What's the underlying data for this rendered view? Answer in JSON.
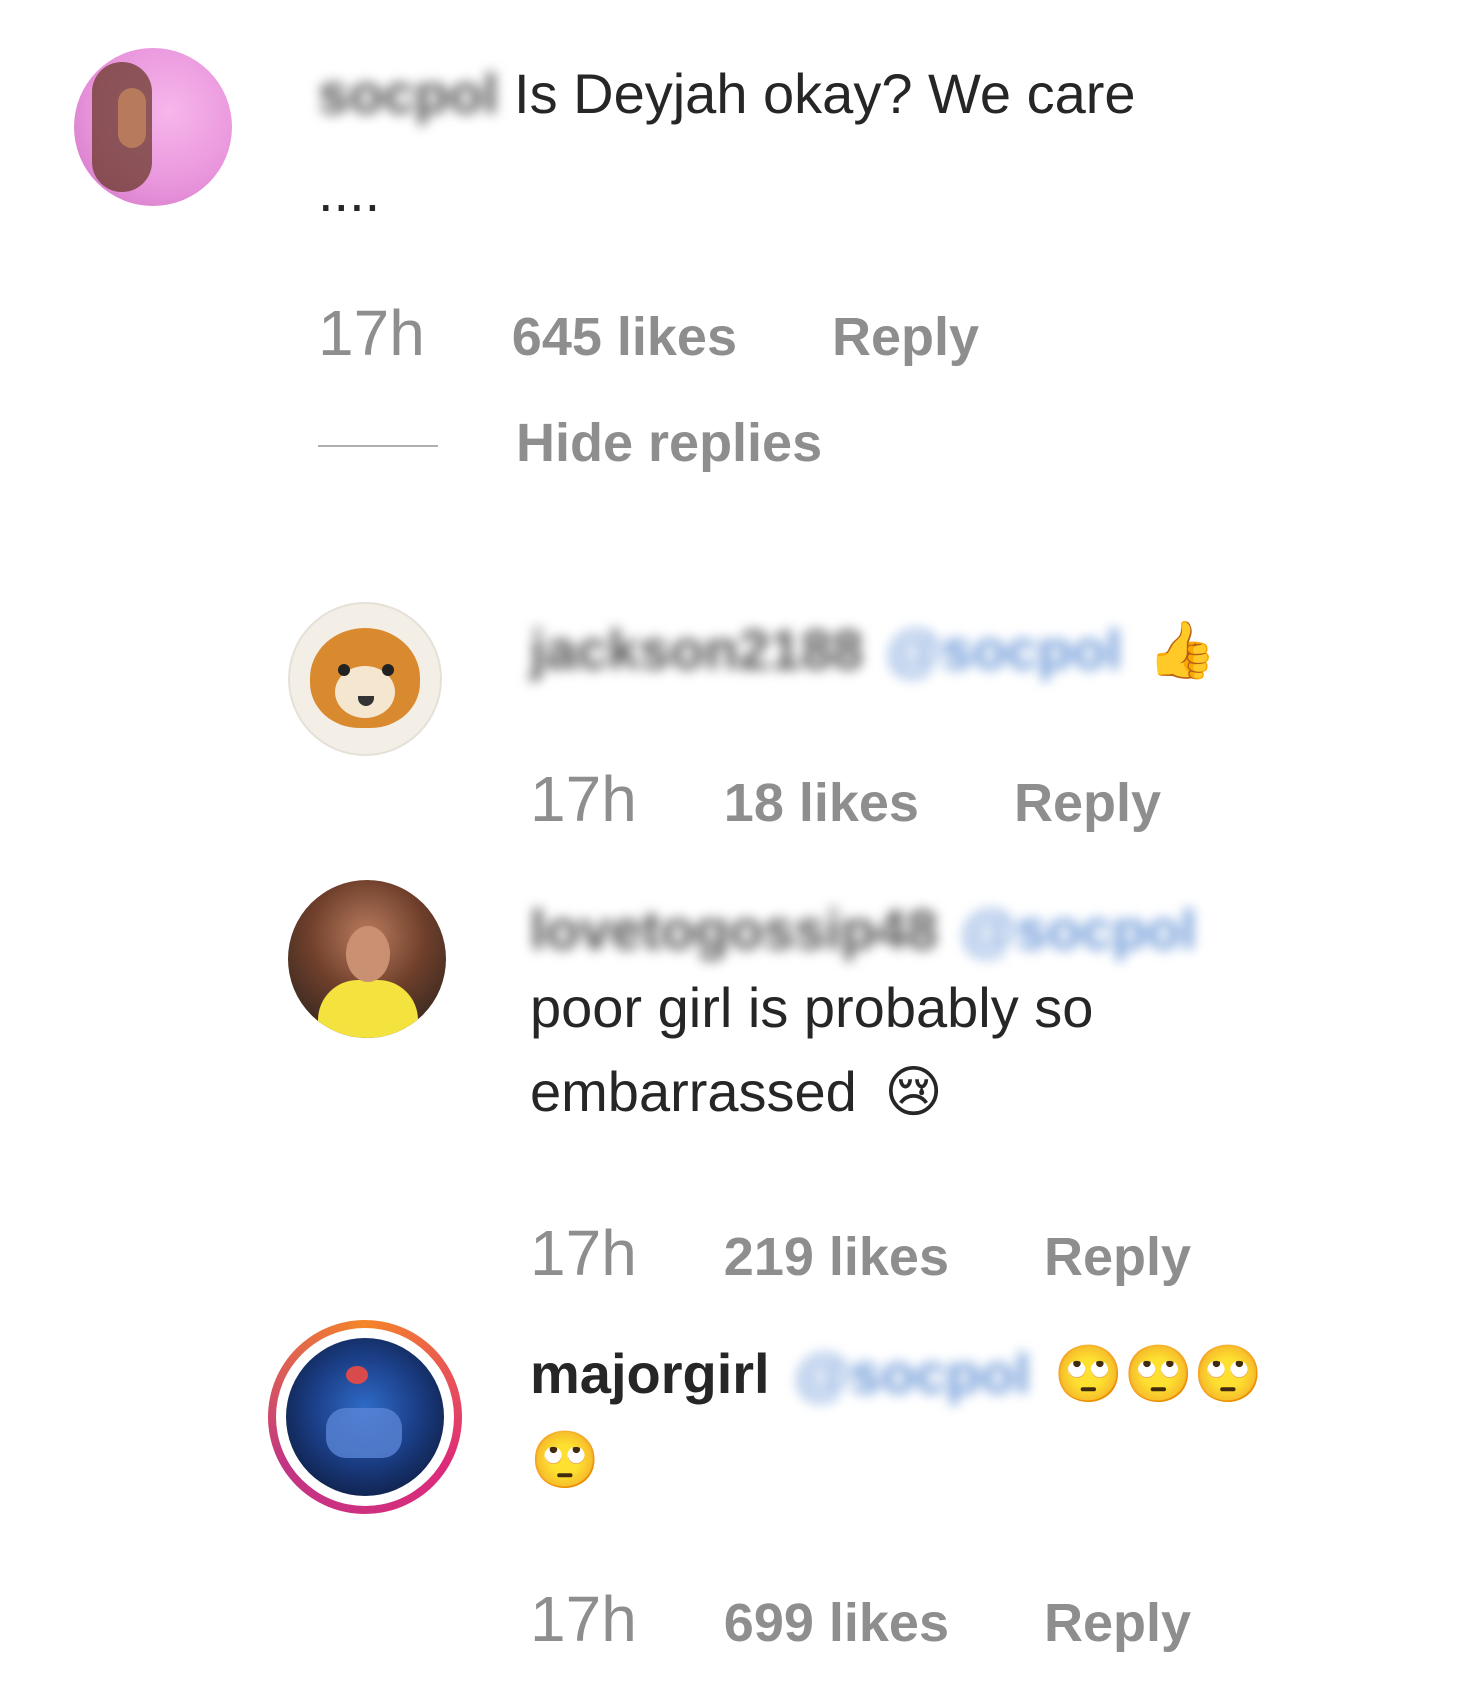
{
  "comments": [
    {
      "username": "socpol",
      "text": "Is Deyjah okay? We care",
      "text_cont": "....",
      "time": "17h",
      "likes": "645 likes",
      "reply": "Reply",
      "hide_replies": "Hide replies"
    }
  ],
  "replies": [
    {
      "username": "jackson2188",
      "mention": "@socpol",
      "emoji": "👍",
      "time": "17h",
      "likes": "18 likes",
      "reply": "Reply"
    },
    {
      "username": "lovetogossip48",
      "mention": "@socpol",
      "text_line1": "poor girl is probably so",
      "text_line2": "embarrassed",
      "emoji": "😢",
      "time": "17h",
      "likes": "219 likes",
      "reply": "Reply"
    },
    {
      "username": "majorgirl",
      "mention": "@socpol",
      "emoji": "🙄🙄🙄",
      "emoji_line2": "🙄",
      "time": "17h",
      "likes": "699 likes",
      "reply": "Reply"
    }
  ],
  "colors": {
    "text": "#262626",
    "meta": "#8e8e8e",
    "mention": "#6f9ad8"
  }
}
